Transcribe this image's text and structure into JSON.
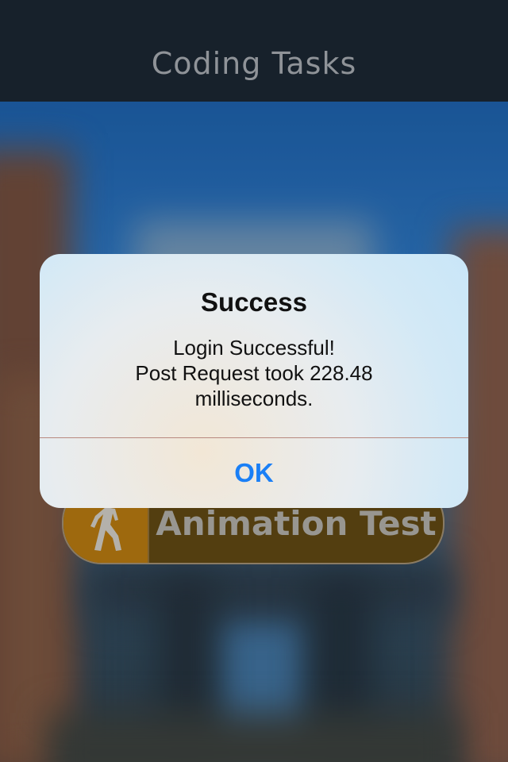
{
  "navbar": {
    "title": "Coding Tasks"
  },
  "background_button": {
    "label": "Animation Test",
    "icon": "walking-person-icon"
  },
  "alert": {
    "title": "Success",
    "message_lines": [
      "Login Successful!",
      "Post Request took 228.48",
      "milliseconds."
    ],
    "ok_label": "OK"
  },
  "colors": {
    "navbar": "#17212b",
    "accent": "#1a7ff6",
    "button_orange": "#b07510"
  }
}
